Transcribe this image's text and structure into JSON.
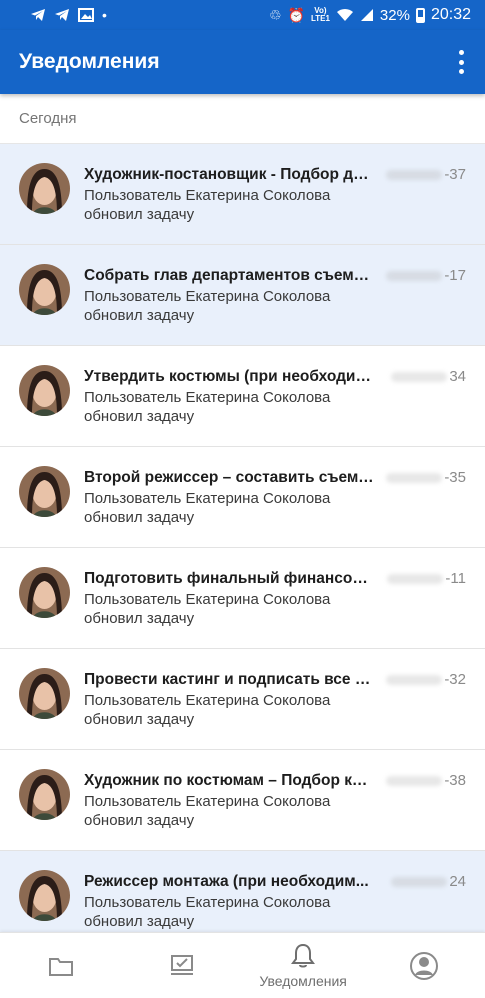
{
  "status_bar": {
    "icons": [
      "telegram-icon",
      "telegram-icon",
      "gallery-icon",
      "dot-icon",
      "recycle-icon",
      "alarm-icon",
      "volte-icon",
      "wifi-icon",
      "signal-icon"
    ],
    "lte_label": "VoLTE1",
    "battery": "32%",
    "time": "20:32"
  },
  "app_bar": {
    "title": "Уведомления",
    "menu_icon": "more-vert-icon",
    "color": "#1565c8"
  },
  "section": {
    "label": "Сегодня"
  },
  "notifications": [
    {
      "title": "Художник-постановщик - Подбор де...",
      "time": "-37",
      "line1": "Пользователь Екатерина Соколова",
      "line2": "обновил задачу",
      "unread": true
    },
    {
      "title": "Собрать глав департаментов съемо...",
      "time": "-17",
      "line1": "Пользователь Екатерина Соколова",
      "line2": "обновил задачу",
      "unread": true
    },
    {
      "title": "Утвердить костюмы (при необходим...",
      "time": "34",
      "line1": "Пользователь Екатерина Соколова",
      "line2": "обновил задачу",
      "unread": false
    },
    {
      "title": "Второй режиссер – составить съемо...",
      "time": "-35",
      "line1": "Пользователь Екатерина Соколова",
      "line2": "обновил задачу",
      "unread": false
    },
    {
      "title": "Подготовить финальный финансовы...",
      "time": "-11",
      "line1": "Пользователь Екатерина Соколова",
      "line2": "обновил задачу",
      "unread": false
    },
    {
      "title": "Провести кастинг и подписать все д...",
      "time": "-32",
      "line1": "Пользователь Екатерина Соколова",
      "line2": "обновил задачу",
      "unread": false
    },
    {
      "title": "Художник по костюмам – Подбор ко...",
      "time": "-38",
      "line1": "Пользователь Екатерина Соколова",
      "line2": "обновил задачу",
      "unread": false
    },
    {
      "title": "Режиссер монтажа (при необходим...",
      "time": "24",
      "line1": "Пользователь Екатерина Соколова",
      "line2": "обновил задачу",
      "unread": true
    }
  ],
  "bottom_nav": {
    "items": [
      {
        "icon": "folder-icon",
        "label": ""
      },
      {
        "icon": "tasks-icon",
        "label": ""
      },
      {
        "icon": "bell-icon",
        "label": "Уведомления",
        "active": true
      },
      {
        "icon": "profile-icon",
        "label": ""
      }
    ]
  }
}
